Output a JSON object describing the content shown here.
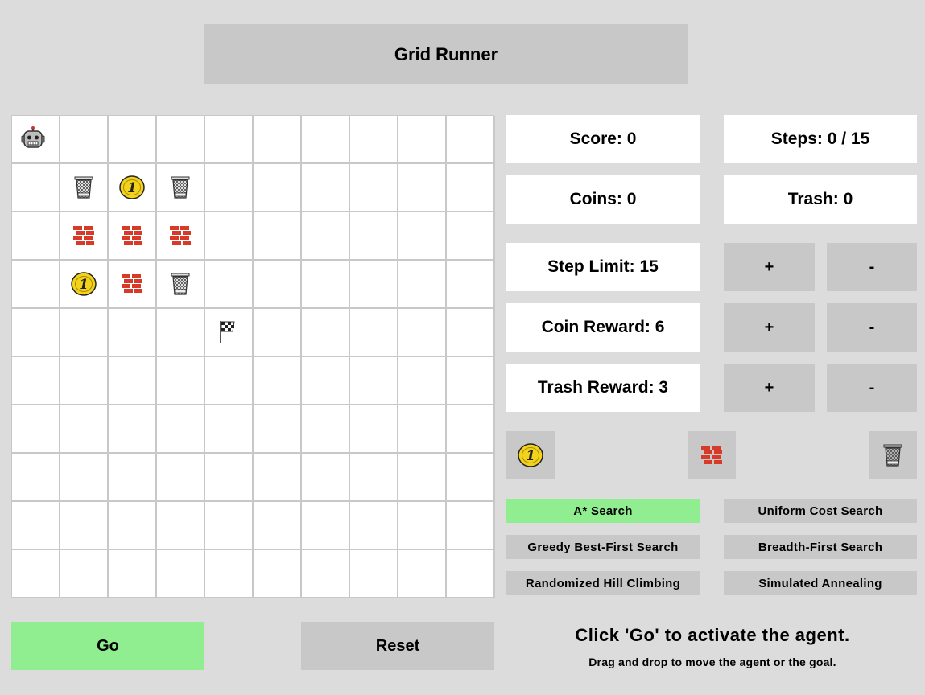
{
  "app": {
    "title": "Grid Runner"
  },
  "stats": {
    "score": "Score: 0",
    "steps": "Steps: 0 / 15",
    "coins": "Coins: 0",
    "trash": "Trash: 0"
  },
  "settings": {
    "step_limit": "Step Limit: 15",
    "coin_reward": "Coin Reward: 6",
    "trash_reward": "Trash Reward: 3",
    "plus_label": "+",
    "minus_label": "-"
  },
  "palette": [
    "coin-icon",
    "brick-wall-icon",
    "trash-can-icon"
  ],
  "algorithms": {
    "astar": "A* Search",
    "ucs": "Uniform Cost Search",
    "greedy": "Greedy Best-First Search",
    "bfs": "Breadth-First Search",
    "hill": "Randomized Hill Climbing",
    "annealing": "Simulated Annealing",
    "selected": "A* Search"
  },
  "controls": {
    "go_label": "Go",
    "reset_label": "Reset"
  },
  "messages": {
    "main": "Click 'Go' to activate the agent.",
    "sub": "Drag and drop to move the agent or the goal."
  },
  "colors": {
    "active": "#90ee90",
    "button": "#c8c8c8",
    "background": "#dcdcdc",
    "brick": "#d83a2a",
    "coin": "#f2d21a"
  },
  "grid": {
    "rows": 10,
    "cols": 10,
    "items": [
      {
        "row": 0,
        "col": 0,
        "type": "agent"
      },
      {
        "row": 1,
        "col": 1,
        "type": "trash"
      },
      {
        "row": 1,
        "col": 2,
        "type": "coin"
      },
      {
        "row": 1,
        "col": 3,
        "type": "trash"
      },
      {
        "row": 2,
        "col": 1,
        "type": "wall"
      },
      {
        "row": 2,
        "col": 2,
        "type": "wall"
      },
      {
        "row": 2,
        "col": 3,
        "type": "wall"
      },
      {
        "row": 3,
        "col": 1,
        "type": "coin"
      },
      {
        "row": 3,
        "col": 2,
        "type": "wall"
      },
      {
        "row": 3,
        "col": 3,
        "type": "trash"
      },
      {
        "row": 4,
        "col": 4,
        "type": "goal"
      }
    ]
  }
}
